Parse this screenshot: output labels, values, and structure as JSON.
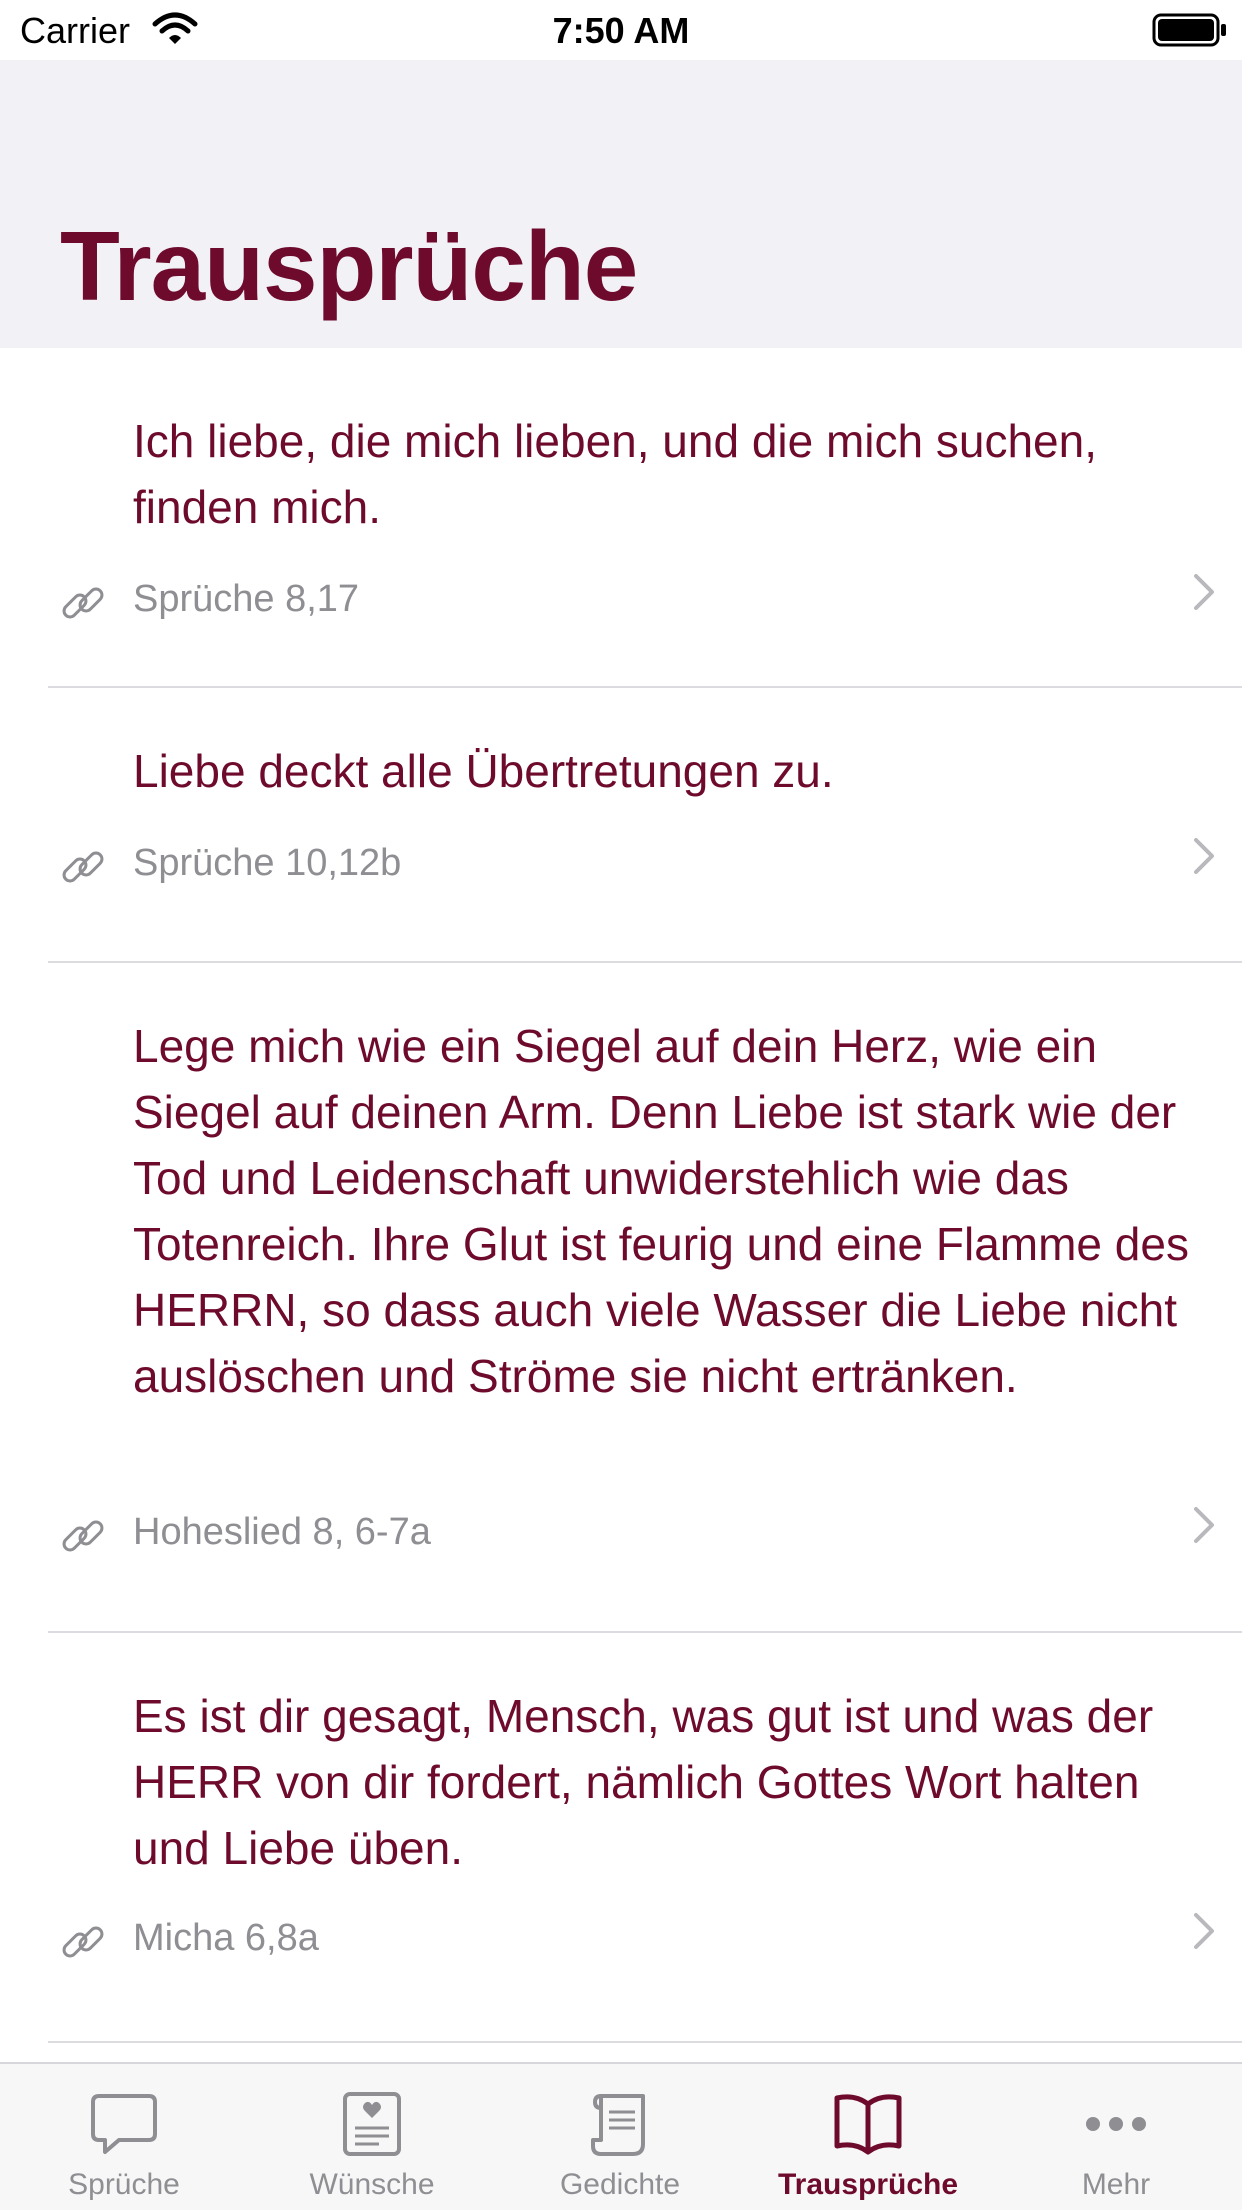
{
  "status": {
    "carrier": "Carrier",
    "time": "7:50 AM"
  },
  "header": {
    "title": "Trausprüche"
  },
  "items": [
    {
      "text": "Ich liebe, die mich lieben, und die mich suchen, finden mich.",
      "reference": "Sprüche 8,17"
    },
    {
      "text": "Liebe deckt alle Übertretungen zu.",
      "reference": "Sprüche 10,12b"
    },
    {
      "text": "Lege mich wie ein Siegel auf dein Herz, wie ein Siegel auf deinen Arm. Denn Liebe ist stark wie der Tod und Leidenschaft unwiderstehlich wie das Totenreich. Ihre Glut ist feurig und eine Flamme des HERRN, so dass auch viele Wasser die Liebe nicht auslöschen und Ströme sie nicht ertränken.",
      "reference": "Hoheslied 8, 6-7a"
    },
    {
      "text": "Es ist dir gesagt, Mensch, was gut ist und was der HERR von dir fordert, nämlich Gottes Wort halten und Liebe üben.",
      "reference": "Micha 6,8a"
    }
  ],
  "tabs": [
    {
      "label": "Sprüche",
      "icon": "speech-bubble-icon"
    },
    {
      "label": "Wünsche",
      "icon": "card-heart-icon"
    },
    {
      "label": "Gedichte",
      "icon": "scroll-icon"
    },
    {
      "label": "Trausprüche",
      "icon": "open-book-icon",
      "active": true
    },
    {
      "label": "Mehr",
      "icon": "more-dots-icon"
    }
  ],
  "colors": {
    "accent": "#6e0b2c",
    "secondary": "#8e8e93",
    "header_bg": "#f2f1f6"
  }
}
